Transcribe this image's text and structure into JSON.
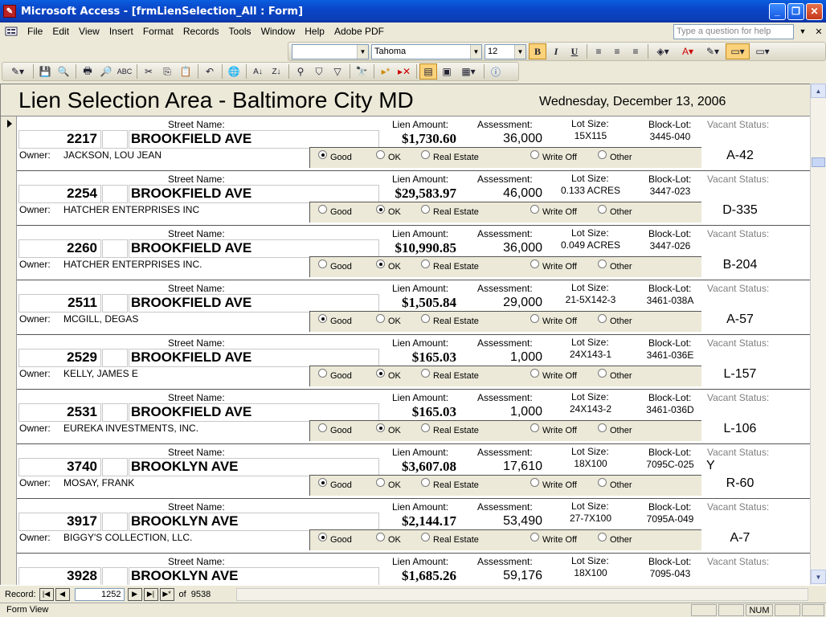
{
  "window": {
    "title": "Microsoft Access - [frmLienSelection_All : Form]",
    "min_label": "_",
    "restore_label": "❐",
    "close_label": "✕"
  },
  "menu": {
    "items": [
      "File",
      "Edit",
      "View",
      "Insert",
      "Format",
      "Records",
      "Tools",
      "Window",
      "Help",
      "Adobe PDF"
    ],
    "help_placeholder": "Type a question for help",
    "close_label": "✕"
  },
  "format_toolbar": {
    "object_combo": "",
    "font": "Tahoma",
    "size": "12"
  },
  "form": {
    "title": "Lien Selection Area - Baltimore City MD",
    "date": "Wednesday, December 13, 2006",
    "labels": {
      "street": "Street Name:",
      "lien": "Lien Amount:",
      "assessment": "Assessment:",
      "lot": "Lot Size:",
      "block": "Block-Lot:",
      "vacant": "Vacant Status:",
      "owner": "Owner:"
    },
    "options": [
      "Good",
      "OK",
      "Real Estate",
      "Write Off",
      "Other"
    ],
    "records": [
      {
        "number": "2217",
        "street": "BROOKFIELD AVE",
        "lien": "$1,730.60",
        "assessment": "36,000",
        "lot": "15X115",
        "block": "3445-040",
        "vacant": "",
        "owner": "JACKSON, LOU JEAN",
        "selected": 0,
        "code": "A-42",
        "current": true
      },
      {
        "number": "2254",
        "street": "BROOKFIELD AVE",
        "lien": "$29,583.97",
        "assessment": "46,000",
        "lot": "0.133 ACRES",
        "block": "3447-023",
        "vacant": "",
        "owner": "HATCHER ENTERPRISES INC",
        "selected": 1,
        "code": "D-335",
        "current": false
      },
      {
        "number": "2260",
        "street": "BROOKFIELD AVE",
        "lien": "$10,990.85",
        "assessment": "36,000",
        "lot": "0.049 ACRES",
        "block": "3447-026",
        "vacant": "",
        "owner": "HATCHER ENTERPRISES INC.",
        "selected": 1,
        "code": "B-204",
        "current": false
      },
      {
        "number": "2511",
        "street": "BROOKFIELD AVE",
        "lien": "$1,505.84",
        "assessment": "29,000",
        "lot": "21-5X142-3",
        "block": "3461-038A",
        "vacant": "",
        "owner": "MCGILL, DEGAS",
        "selected": 0,
        "code": "A-57",
        "current": false
      },
      {
        "number": "2529",
        "street": "BROOKFIELD AVE",
        "lien": "$165.03",
        "assessment": "1,000",
        "lot": "24X143-1",
        "block": "3461-036E",
        "vacant": "",
        "owner": "KELLY, JAMES E",
        "selected": 1,
        "code": "L-157",
        "current": false
      },
      {
        "number": "2531",
        "street": "BROOKFIELD AVE",
        "lien": "$165.03",
        "assessment": "1,000",
        "lot": "24X143-2",
        "block": "3461-036D",
        "vacant": "",
        "owner": "EUREKA INVESTMENTS, INC.",
        "selected": 1,
        "code": "L-106",
        "current": false
      },
      {
        "number": "3740",
        "street": "BROOKLYN AVE",
        "lien": "$3,607.08",
        "assessment": "17,610",
        "lot": "18X100",
        "block": "7095C-025",
        "vacant": "Y",
        "owner": "MOSAY, FRANK",
        "selected": 0,
        "code": "R-60",
        "current": false
      },
      {
        "number": "3917",
        "street": "BROOKLYN AVE",
        "lien": "$2,144.17",
        "assessment": "53,490",
        "lot": "27-7X100",
        "block": "7095A-049",
        "vacant": "",
        "owner": "BIGGY'S COLLECTION, LLC.",
        "selected": 0,
        "code": "A-7",
        "current": false
      },
      {
        "number": "3928",
        "street": "BROOKLYN AVE",
        "lien": "$1,685.26",
        "assessment": "59,176",
        "lot": "18X100",
        "block": "7095-043",
        "vacant": "",
        "owner": "",
        "selected": -1,
        "code": "",
        "current": false
      }
    ]
  },
  "navigation": {
    "label": "Record:",
    "current": "1252",
    "of_label": "of",
    "total": "9538",
    "first_icon": "first-record-icon",
    "prev_icon": "previous-record-icon",
    "next_icon": "next-record-icon",
    "last_icon": "last-record-icon",
    "new_icon": "new-record-icon"
  },
  "status": {
    "text": "Form View",
    "num": "NUM"
  }
}
